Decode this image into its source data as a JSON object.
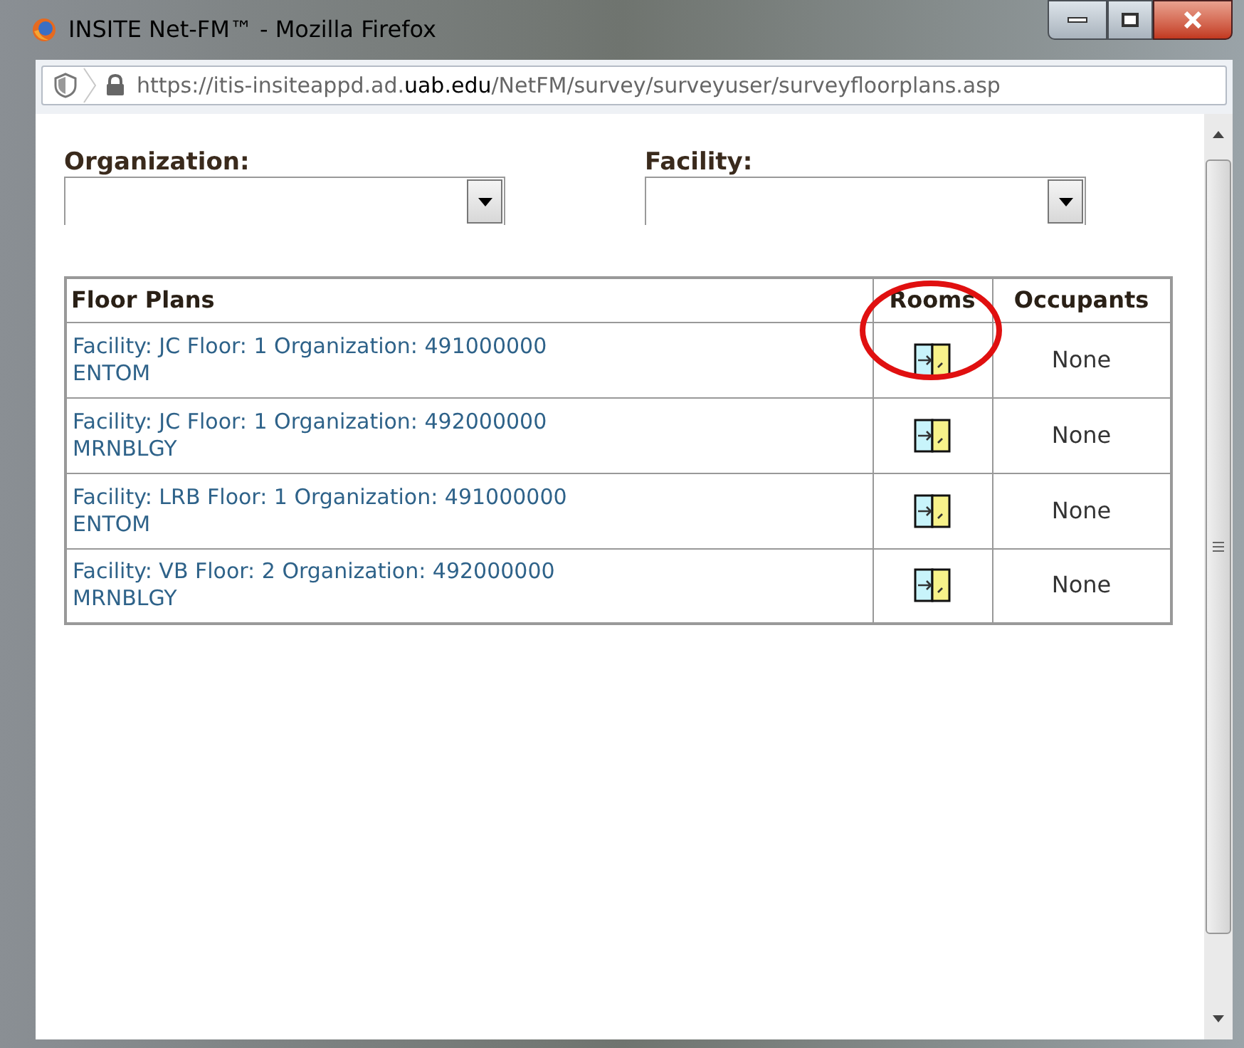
{
  "window": {
    "title": "INSITE Net-FM™ - Mozilla Firefox"
  },
  "address_bar": {
    "url_parts": [
      {
        "text": "https://itis-insiteappd.ad.",
        "bold": false
      },
      {
        "text": "uab.edu",
        "bold": true
      },
      {
        "text": "/NetFM/survey/surveyuser/surveyfloorplans.asp",
        "bold": false
      }
    ]
  },
  "filters": [
    {
      "label": "Organization:"
    },
    {
      "label": "Facility:"
    }
  ],
  "table": {
    "columns": [
      "Floor Plans",
      "Rooms",
      "Occupants"
    ],
    "rows": [
      {
        "floor_plan": [
          "Facility: JC Floor: 1 Organization: 491000000",
          "ENTOM"
        ],
        "occupants": "None",
        "circled": true
      },
      {
        "floor_plan": [
          "Facility: JC Floor: 1 Organization: 492000000",
          "MRNBLGY"
        ],
        "occupants": "None",
        "circled": false
      },
      {
        "floor_plan": [
          "Facility: LRB Floor: 1 Organization: 491000000",
          "ENTOM"
        ],
        "occupants": "None",
        "circled": false
      },
      {
        "floor_plan": [
          "Facility: VB Floor: 2 Organization: 492000000",
          "MRNBLGY"
        ],
        "occupants": "None",
        "circled": false
      }
    ]
  }
}
